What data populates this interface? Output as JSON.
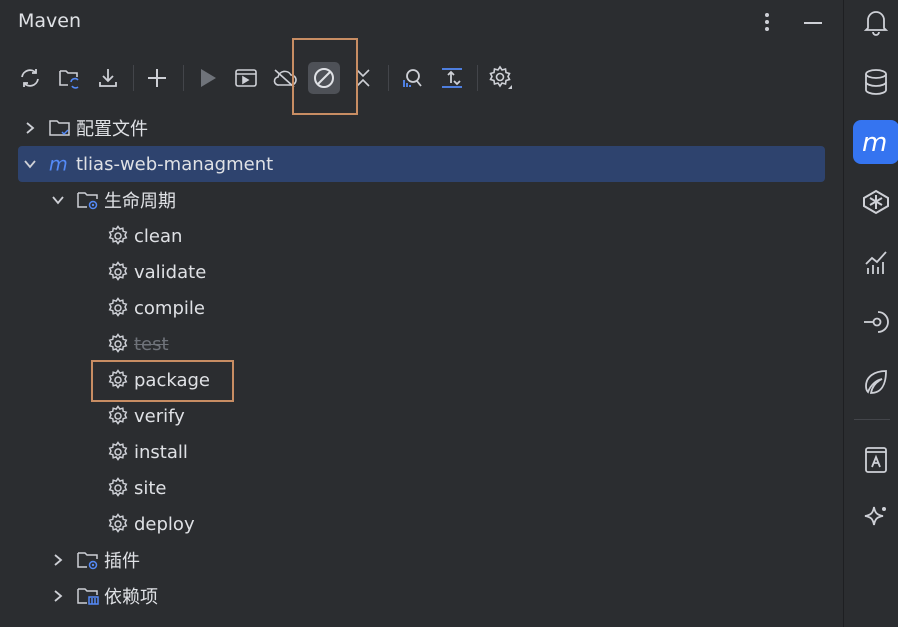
{
  "panel": {
    "title": "Maven"
  },
  "toolbar": {
    "items": [
      {
        "icon": "reload-icon"
      },
      {
        "icon": "reload-folder-icon"
      },
      {
        "icon": "download-icon"
      },
      {
        "icon": "add-icon"
      },
      {
        "icon": "run-icon"
      },
      {
        "icon": "execute-goal-icon"
      },
      {
        "icon": "offline-mode-icon"
      },
      {
        "icon": "skip-tests-icon",
        "active": true
      },
      {
        "icon": "collapse-icon"
      },
      {
        "icon": "analyze-dependencies-icon"
      },
      {
        "icon": "expand-all-icon"
      },
      {
        "icon": "settings-icon"
      }
    ]
  },
  "tree": {
    "profiles_label": "配置文件",
    "project_label": "tlias-web-managment",
    "lifecycle_label": "生命周期",
    "lifecycle_goals": [
      "clean",
      "validate",
      "compile",
      "test",
      "package",
      "verify",
      "install",
      "site",
      "deploy"
    ],
    "skipped_goal": "test",
    "highlighted_goal": "package",
    "plugins_label": "插件",
    "dependencies_label": "依赖项"
  },
  "right_stripe": {
    "items": [
      "notifications-icon",
      "database-icon",
      "maven-icon",
      "bean-icon",
      "chart-icon",
      "endpoints-icon",
      "spring-icon",
      "ai-assistant-doc-icon",
      "sparkle-icon"
    ],
    "active": "maven-icon"
  },
  "colors": {
    "background": "#2b2d30",
    "selection": "#2e436e",
    "accent": "#3574f0",
    "highlight_box": "#c88d63",
    "maven_m": "#548af7"
  }
}
